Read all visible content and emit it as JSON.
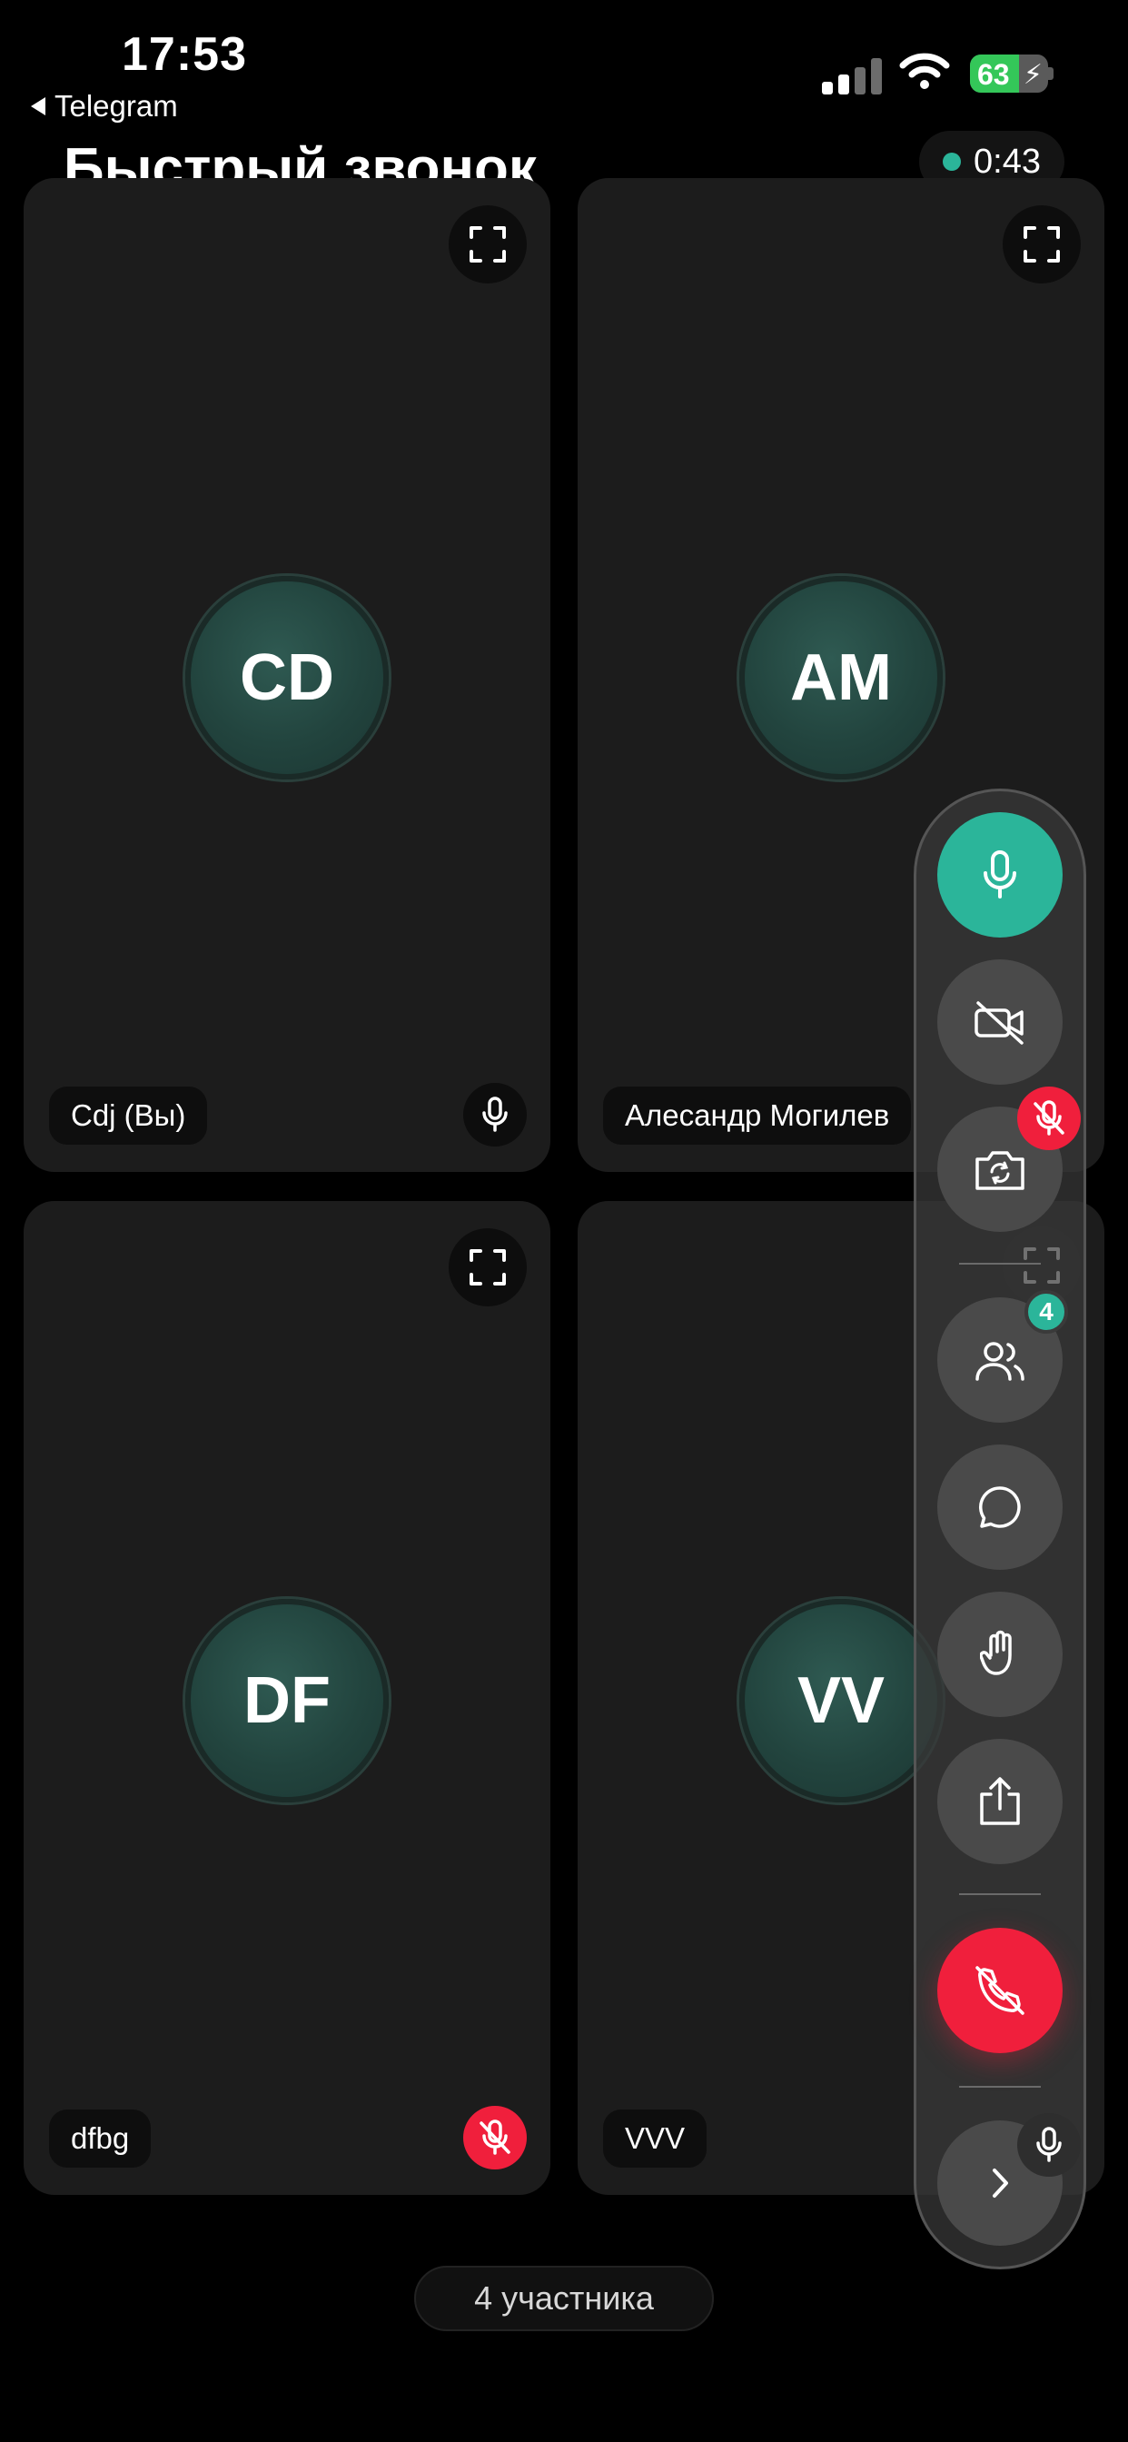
{
  "status_bar": {
    "time": "17:53",
    "back_app": "Telegram",
    "battery": "63",
    "battery_level": 0.63
  },
  "header": {
    "title": "Быстрый звонок",
    "timer": "0:43"
  },
  "tiles": [
    {
      "initials": "CD",
      "name": "Cdj (Вы)",
      "muted": false
    },
    {
      "initials": "AM",
      "name": "Алесандр Могилев",
      "muted": true
    },
    {
      "initials": "DF",
      "name": "dfbg",
      "muted": true
    },
    {
      "initials": "VV",
      "name": "VVV",
      "muted": false
    }
  ],
  "controls": {
    "participants_badge": "4"
  },
  "footer": {
    "participants_label": "4 участника"
  },
  "colors": {
    "accent": "#2bb59a",
    "danger": "#f01f3c",
    "tile": "#1c1c1c"
  },
  "icons": [
    "expand-icon",
    "mic-icon",
    "mic-off-icon",
    "camera-off-icon",
    "flip-camera-icon",
    "people-icon",
    "chat-icon",
    "raise-hand-icon",
    "share-icon",
    "end-call-icon",
    "chevron-right-icon"
  ]
}
